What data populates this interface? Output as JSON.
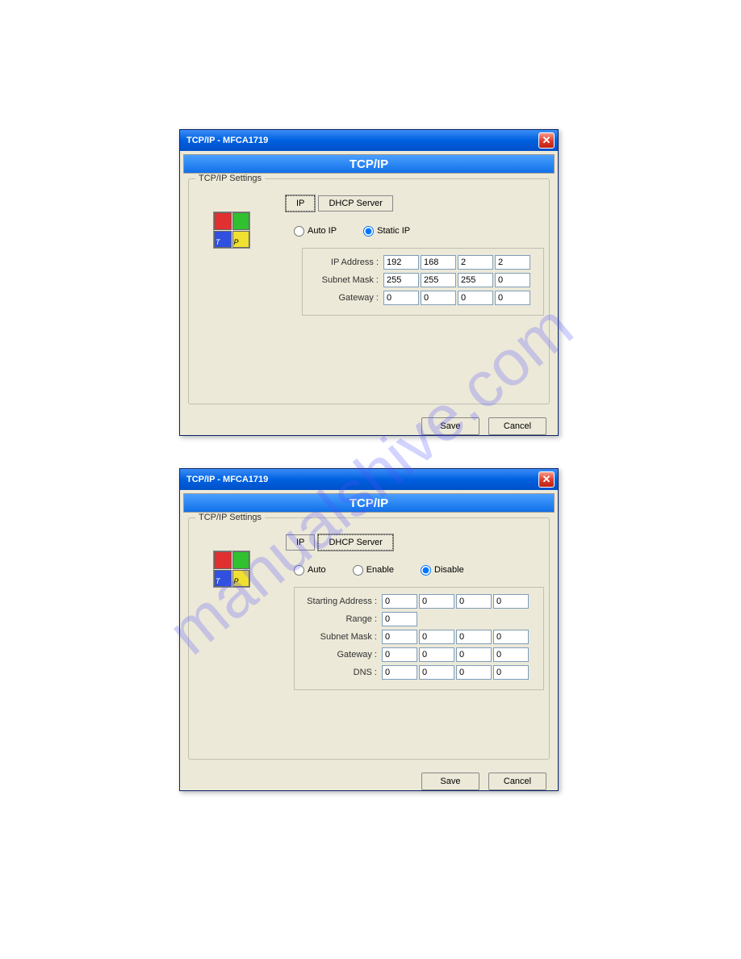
{
  "watermark": "manualshive.com",
  "dialog1": {
    "title": "TCP/IP - MFCA1719",
    "banner": "TCP/IP",
    "group_legend": "TCP/IP Settings",
    "tabs": {
      "ip": "IP",
      "dhcp": "DHCP Server"
    },
    "radios": {
      "auto": "Auto IP",
      "static": "Static IP"
    },
    "labels": {
      "ip": "IP Address :",
      "mask": "Subnet Mask :",
      "gw": "Gateway :"
    },
    "values": {
      "ip": [
        "192",
        "168",
        "2",
        "2"
      ],
      "mask": [
        "255",
        "255",
        "255",
        "0"
      ],
      "gw": [
        "0",
        "0",
        "0",
        "0"
      ]
    },
    "buttons": {
      "save": "Save",
      "cancel": "Cancel"
    }
  },
  "dialog2": {
    "title": "TCP/IP - MFCA1719",
    "banner": "TCP/IP",
    "group_legend": "TCP/IP Settings",
    "tabs": {
      "ip": "IP",
      "dhcp": "DHCP Server"
    },
    "radios": {
      "auto": "Auto",
      "enable": "Enable",
      "disable": "Disable"
    },
    "labels": {
      "start": "Starting Address :",
      "range": "Range :",
      "mask": "Subnet Mask :",
      "gw": "Gateway :",
      "dns": "DNS :"
    },
    "values": {
      "start": [
        "0",
        "0",
        "0",
        "0"
      ],
      "range": [
        "0"
      ],
      "mask": [
        "0",
        "0",
        "0",
        "0"
      ],
      "gw": [
        "0",
        "0",
        "0",
        "0"
      ],
      "dns": [
        "0",
        "0",
        "0",
        "0"
      ]
    },
    "buttons": {
      "save": "Save",
      "cancel": "Cancel"
    }
  }
}
